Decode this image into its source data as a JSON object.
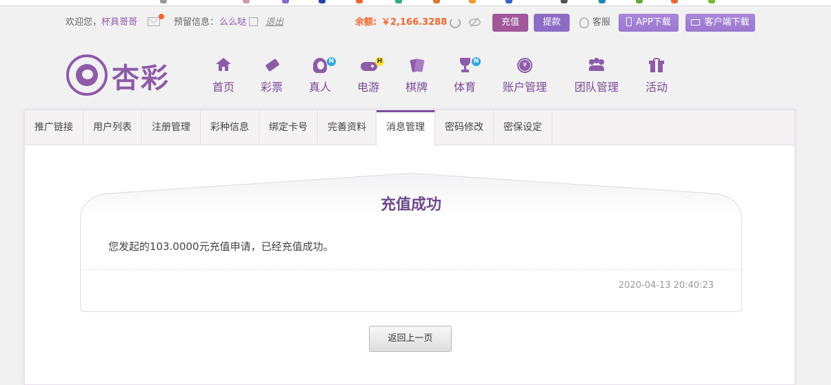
{
  "header": {
    "welcome_label": "欢迎您，",
    "username": "杯具哥哥",
    "reserve_label": "预留信息：",
    "reserve_value": "么么哒",
    "logout_label": "退出",
    "balance_label": "余额:",
    "balance_value": "￥2,166.3288",
    "recharge_label": "充值",
    "withdraw_label": "提款",
    "service_label": "客服",
    "app_download_label": "APP下载",
    "client_download_label": "客户端下载"
  },
  "logo": {
    "text": "杏彩"
  },
  "nav": [
    {
      "label": "首页",
      "icon": "home-icon",
      "badge": ""
    },
    {
      "label": "彩票",
      "icon": "lottery-ticket-icon",
      "badge": ""
    },
    {
      "label": "真人",
      "icon": "live-dealer-icon",
      "badge": "N"
    },
    {
      "label": "电游",
      "icon": "gamepad-icon",
      "badge": "H"
    },
    {
      "label": "棋牌",
      "icon": "playing-cards-icon",
      "badge": ""
    },
    {
      "label": "体育",
      "icon": "trophy-icon",
      "badge": "N"
    },
    {
      "label": "账户管理",
      "icon": "yen-coin-icon",
      "badge": ""
    },
    {
      "label": "团队管理",
      "icon": "team-icon",
      "badge": ""
    },
    {
      "label": "活动",
      "icon": "gift-icon",
      "badge": ""
    }
  ],
  "tabs": [
    {
      "label": "推广链接",
      "active": false
    },
    {
      "label": "用户列表",
      "active": false
    },
    {
      "label": "注册管理",
      "active": false
    },
    {
      "label": "彩种信息",
      "active": false
    },
    {
      "label": "绑定卡号",
      "active": false
    },
    {
      "label": "完善资料",
      "active": false
    },
    {
      "label": "消息管理",
      "active": true
    },
    {
      "label": "密码修改",
      "active": false
    },
    {
      "label": "密保设定",
      "active": false
    }
  ],
  "message": {
    "title": "充值成功",
    "body": "您发起的103.0000元充值申请，已经充值成功。",
    "time": "2020-04-13 20:40:23"
  },
  "back_button_label": "返回上一页",
  "colors": {
    "brand_purple": "#8d5ba8",
    "balance_orange": "#f0652f",
    "recharge_button": "#a0589a",
    "withdraw_button": "#8d6cc6"
  }
}
